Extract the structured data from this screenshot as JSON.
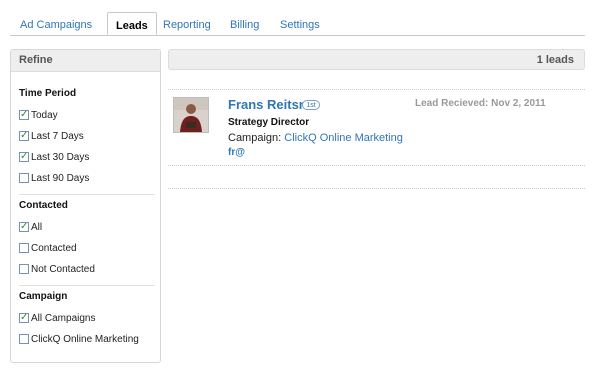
{
  "tabs": [
    {
      "label": "Ad Campaigns",
      "active": false
    },
    {
      "label": "Leads",
      "active": true
    },
    {
      "label": "Reporting",
      "active": false
    },
    {
      "label": "Billing",
      "active": false
    },
    {
      "label": "Settings",
      "active": false
    }
  ],
  "sidebar": {
    "title": "Refine",
    "time_period": {
      "title": "Time Period",
      "options": [
        {
          "label": "Today",
          "checked": true
        },
        {
          "label": "Last 7 Days",
          "checked": true
        },
        {
          "label": "Last 30 Days",
          "checked": true
        },
        {
          "label": "Last 90 Days",
          "checked": false
        }
      ]
    },
    "contacted": {
      "title": "Contacted",
      "options": [
        {
          "label": "All",
          "checked": true
        },
        {
          "label": "Contacted",
          "checked": false
        },
        {
          "label": "Not Contacted",
          "checked": false
        }
      ]
    },
    "campaign": {
      "title": "Campaign",
      "options": [
        {
          "label": "All Campaigns",
          "checked": true
        },
        {
          "label": "ClickQ Online Marketing",
          "checked": false
        }
      ]
    }
  },
  "main": {
    "count_label": "1 leads",
    "lead": {
      "name": "Frans Reitsma",
      "degree": "1st",
      "title": "Strategy Director",
      "campaign_prefix": "Campaign:",
      "campaign_name": "ClickQ Online Marketing",
      "email": "fr@",
      "received": "Lead Recieved: Nov 2, 2011"
    }
  },
  "colors": {
    "link": "#2f76b7",
    "check": "#2a8a2a",
    "header_bg": "#eeeeee"
  }
}
